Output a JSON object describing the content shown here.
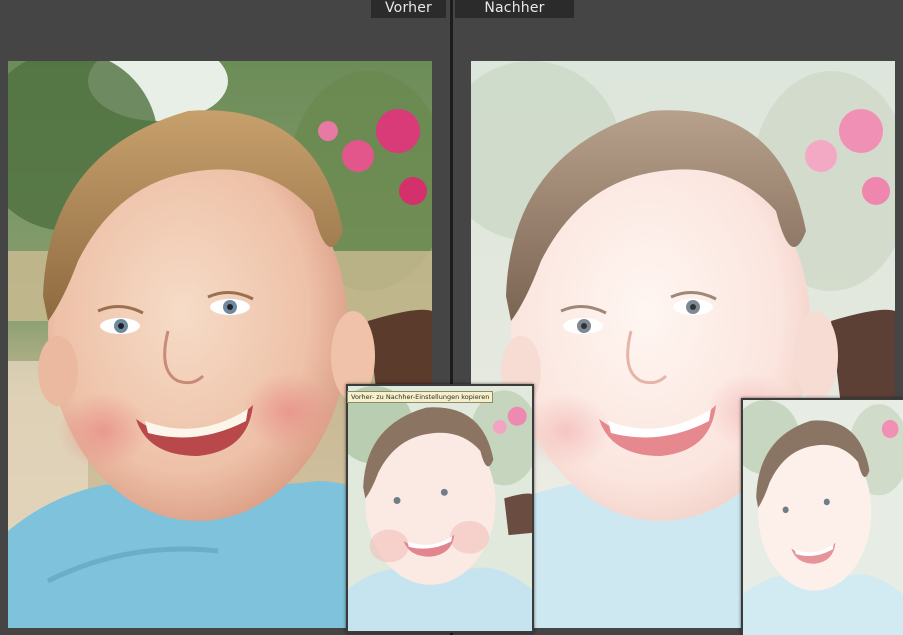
{
  "header": {
    "before_label": "Vorher",
    "after_label": "Nachher"
  },
  "tooltip": {
    "text": "Vorher- zu Nachher-Einstellungen kopieren"
  },
  "colors": {
    "background": "#454545",
    "label_background": "#2b2b2b",
    "label_text": "#e8e8e8",
    "divider": "#1c1c1c",
    "tooltip_background": "#f6f0c8"
  },
  "icons": {
    "before_photo": "child-portrait-original",
    "after_photo": "child-portrait-softened"
  }
}
